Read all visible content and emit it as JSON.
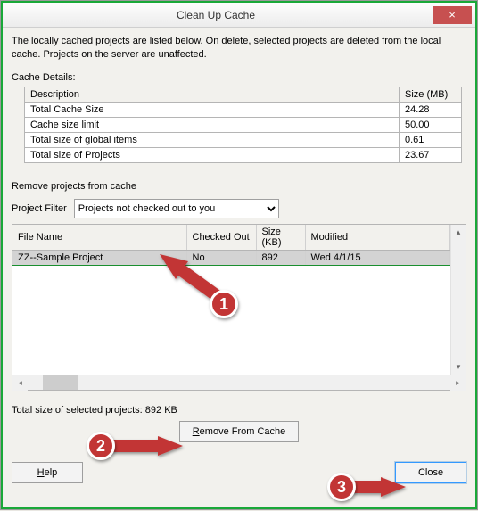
{
  "window": {
    "title": "Clean Up Cache",
    "close_icon": "×"
  },
  "intro": "The locally cached projects are listed below. On delete, selected projects are deleted from the local cache. Projects on the server are unaffected.",
  "cache_details": {
    "label": "Cache Details:",
    "columns": {
      "desc": "Description",
      "size": "Size (MB)"
    },
    "rows": [
      {
        "desc": "Total Cache Size",
        "size": "24.28"
      },
      {
        "desc": "Cache size limit",
        "size": "50.00"
      },
      {
        "desc": "Total size of global items",
        "size": "0.61"
      },
      {
        "desc": "Total size of Projects",
        "size": "23.67"
      }
    ]
  },
  "remove": {
    "label": "Remove projects from cache",
    "filter_label": "Project Filter",
    "filter_value": "Projects not checked out to you",
    "columns": {
      "file": "File Name",
      "checked": "Checked Out",
      "size": "Size (KB)",
      "modified": "Modified"
    },
    "rows": [
      {
        "file": "ZZ--Sample Project",
        "checked": "No",
        "size": "892",
        "modified": "Wed 4/1/15",
        "selected": true
      }
    ]
  },
  "summary": "Total size of selected projects: 892 KB",
  "buttons": {
    "remove": "Remove From Cache",
    "help": "Help",
    "close": "Close"
  },
  "annotations": {
    "1": "1",
    "2": "2",
    "3": "3"
  }
}
